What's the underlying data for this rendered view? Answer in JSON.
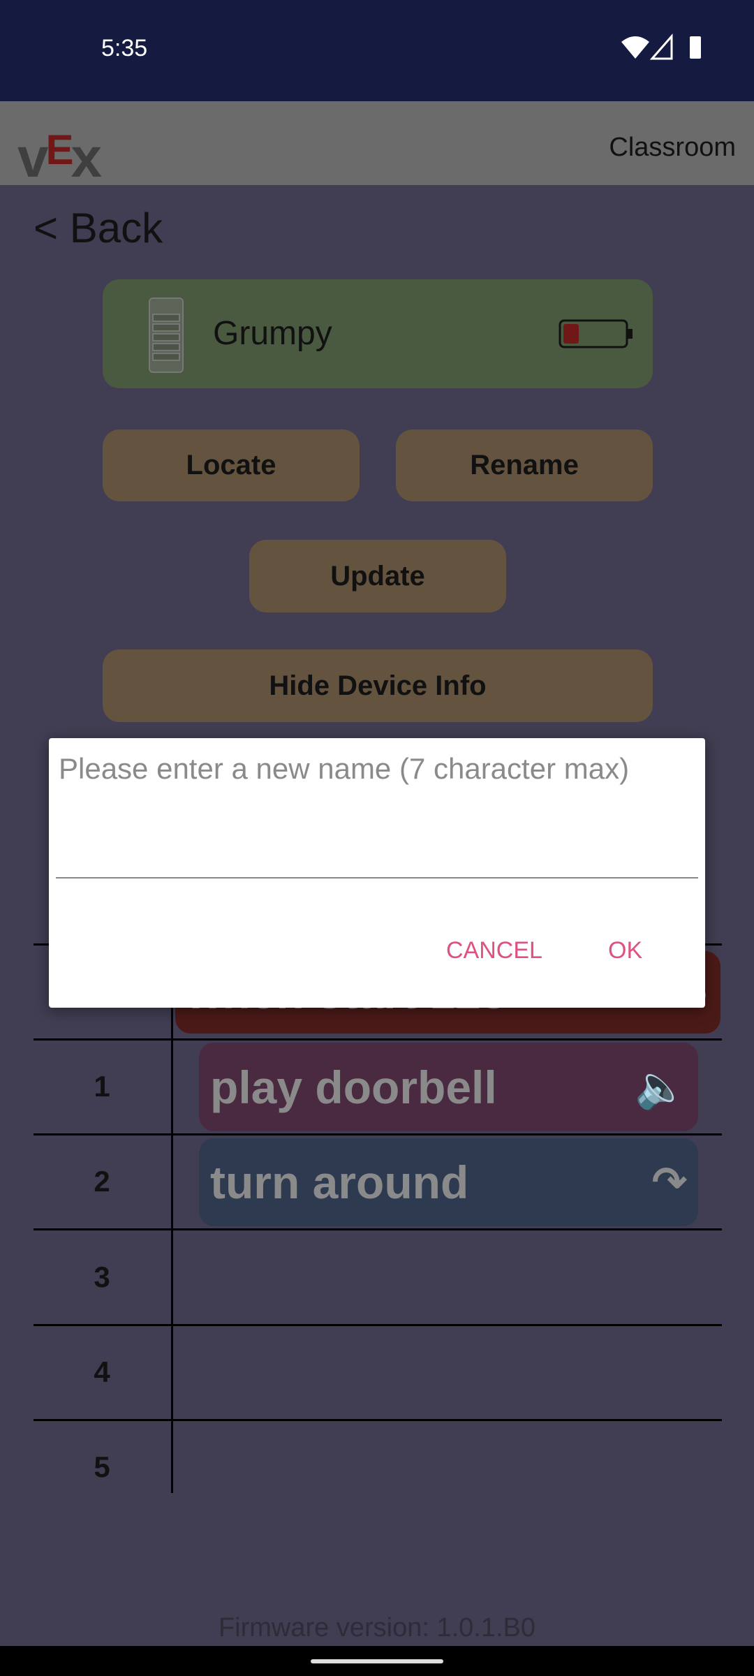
{
  "status_bar": {
    "time": "5:35",
    "icons": [
      "wifi-icon",
      "signal-icon",
      "battery-icon"
    ]
  },
  "header": {
    "logo": "VEX",
    "title": "Classroom"
  },
  "back_label": "< Back",
  "device": {
    "name": "Grumpy",
    "battery_level": 0.15,
    "battery_color": "#701818"
  },
  "buttons": {
    "locate": "Locate",
    "rename": "Rename",
    "update": "Update",
    "hide_info": "Hide Device Info"
  },
  "dialog": {
    "placeholder": "Please enter a new name (7 character max)",
    "value": "",
    "cancel": "CANCEL",
    "ok": "OK"
  },
  "table": {
    "rows": [
      {
        "num": "",
        "block": "when start 123",
        "color": "#4a1a18",
        "icon": "play-icon"
      },
      {
        "num": "1",
        "block": "play doorbell",
        "color": "#4a2a40",
        "icon": "speaker-icon"
      },
      {
        "num": "2",
        "block": "turn around",
        "color": "#2e3a50",
        "icon": "turn-around-icon"
      },
      {
        "num": "3"
      },
      {
        "num": "4"
      },
      {
        "num": "5"
      }
    ]
  },
  "firmware": "Firmware version: 1.0.1.B0",
  "colors": {
    "accent": "#e0527e",
    "button": "#64533f",
    "card": "#4a5a40"
  }
}
